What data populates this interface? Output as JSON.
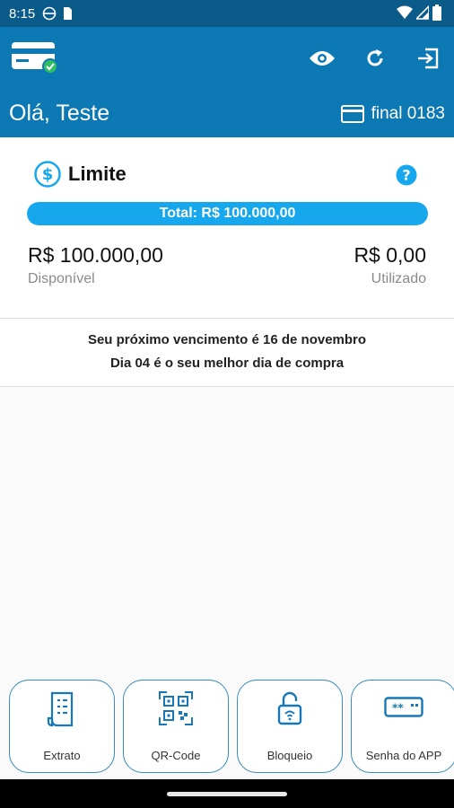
{
  "status_bar": {
    "time": "8:15"
  },
  "header": {
    "greeting": "Olá, Teste",
    "card_final": "final 0183",
    "icons": [
      "card-check-icon",
      "eye-icon",
      "refresh-icon",
      "logout-icon"
    ]
  },
  "limit": {
    "title": "Limite",
    "total_label": "Total: R$ 100.000,00",
    "available_value": "R$ 100.000,00",
    "available_label": "Disponível",
    "used_value": "R$ 0,00",
    "used_label": "Utilizado",
    "available_fraction": 1.0
  },
  "due_info": {
    "line1": "Seu próximo vencimento é 16 de novembro",
    "line2": "Dia 04 é o seu melhor dia de compra"
  },
  "actions": [
    {
      "label": "Extrato",
      "icon": "receipt-icon"
    },
    {
      "label": "QR-Code",
      "icon": "qr-code-icon"
    },
    {
      "label": "Bloqueio",
      "icon": "unlock-icon"
    },
    {
      "label": "Senha do APP",
      "icon": "password-icon"
    }
  ],
  "colors": {
    "primary": "#0c78b4",
    "status_bar": "#0a5a8a",
    "accent": "#16a7ec",
    "action_border": "#3a8bbf",
    "icon_blue": "#1678b8"
  }
}
